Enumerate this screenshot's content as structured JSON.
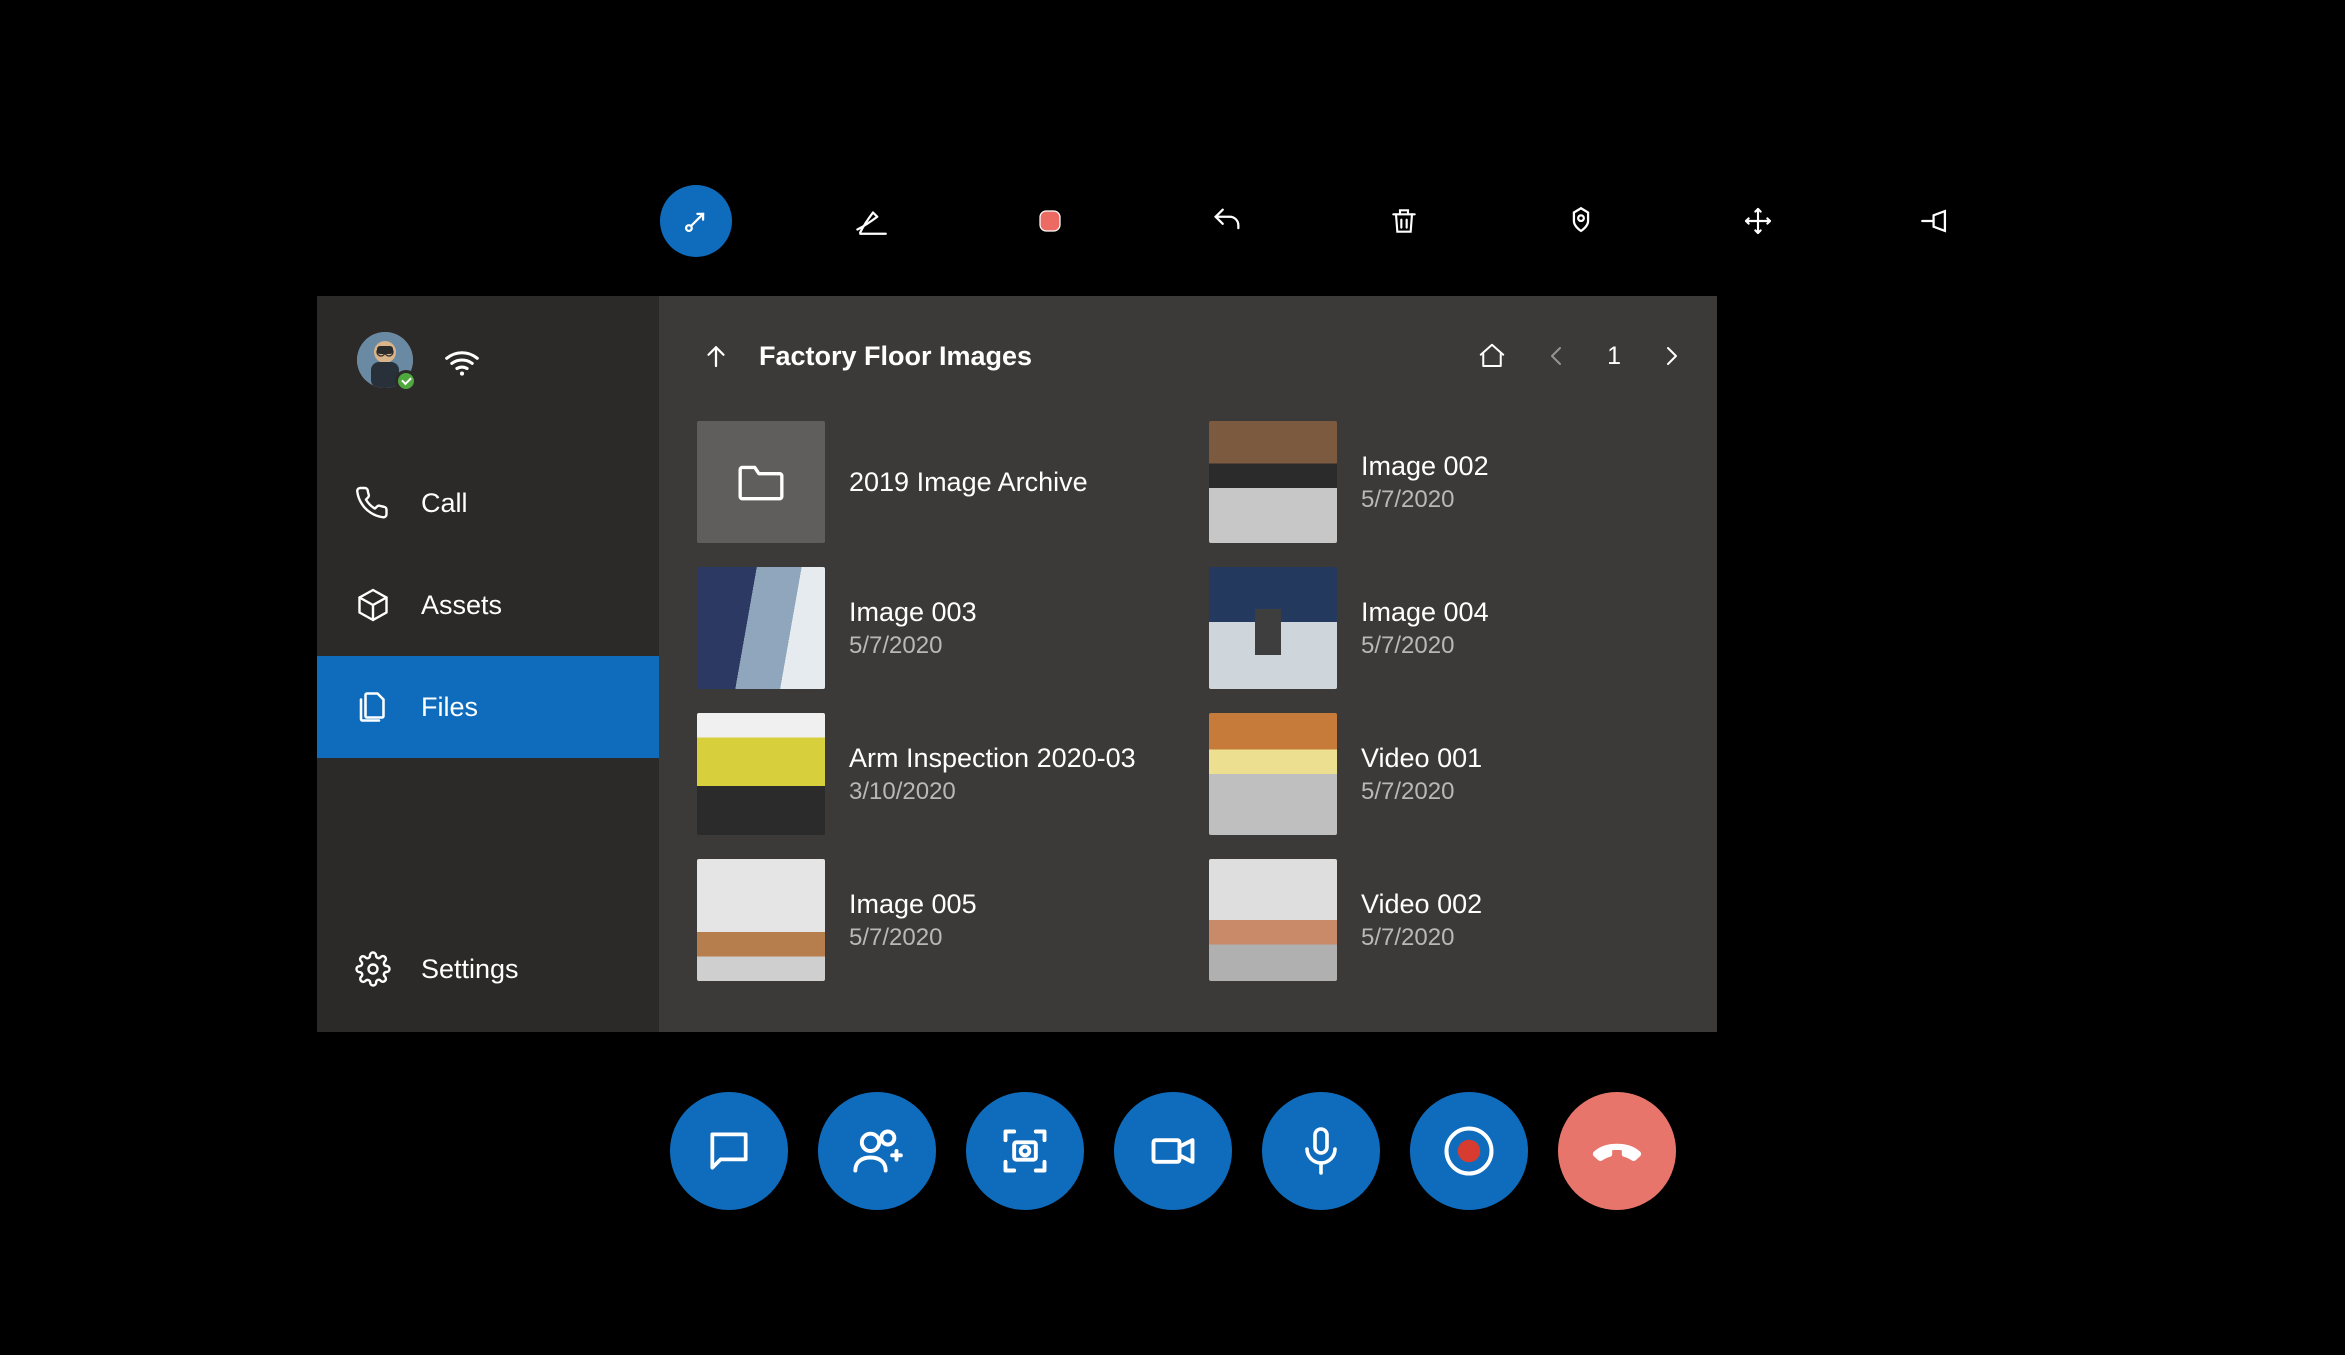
{
  "sidebar": {
    "items": [
      {
        "label": "Call"
      },
      {
        "label": "Assets"
      },
      {
        "label": "Files"
      },
      {
        "label": "Settings"
      }
    ],
    "activeIndex": 2
  },
  "content": {
    "folderTitle": "Factory Floor Images",
    "page": "1",
    "files": [
      {
        "name": "2019 Image Archive",
        "date": "",
        "kind": "folder"
      },
      {
        "name": "Image 002",
        "date": "5/7/2020",
        "kind": "image"
      },
      {
        "name": "Image 003",
        "date": "5/7/2020",
        "kind": "image"
      },
      {
        "name": "Image 004",
        "date": "5/7/2020",
        "kind": "image"
      },
      {
        "name": "Arm Inspection 2020-03",
        "date": "3/10/2020",
        "kind": "image"
      },
      {
        "name": "Video 001",
        "date": "5/7/2020",
        "kind": "video"
      },
      {
        "name": "Image 005",
        "date": "5/7/2020",
        "kind": "image"
      },
      {
        "name": "Video 002",
        "date": "5/7/2020",
        "kind": "video"
      }
    ]
  }
}
